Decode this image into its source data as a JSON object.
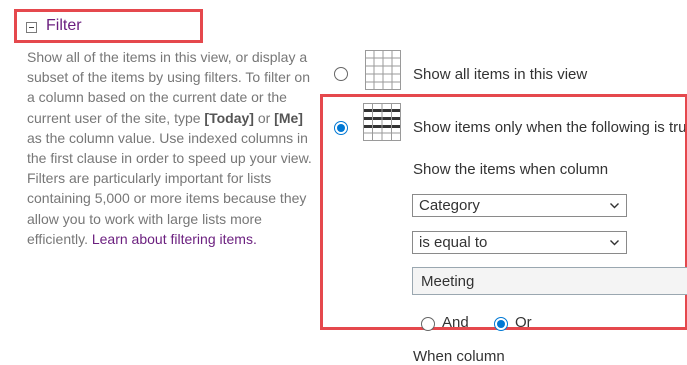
{
  "section": {
    "title": "Filter",
    "description_parts": [
      "Show all of the items in this view, or display a subset of the items by using filters. To filter on a column based on the current date or the current user of the site, type ",
      "[Today]",
      " or ",
      "[Me]",
      " as the column value. Use indexed columns in the first clause in order to speed up your view. Filters are particularly important for lists containing 5,000 or more items because they allow you to work with large lists more efficiently. "
    ],
    "learn_link": "Learn about filtering items."
  },
  "options": {
    "show_all_label": "Show all items in this view",
    "show_filtered_label": "Show items only when the following is true:",
    "selected": "filtered"
  },
  "filter": {
    "caption": "Show the items when column",
    "column": "Category",
    "operator": "is equal to",
    "value": "Meeting",
    "and_label": "And",
    "or_label": "Or",
    "logic_selected": "Or",
    "next_caption": "When column"
  },
  "colors": {
    "highlight": "#e5484d",
    "accent": "#0078d4",
    "title": "#6b1f7f"
  },
  "icons": {
    "collapse": "minus-square-icon",
    "view_all": "grid-icon",
    "view_filtered": "filtered-grid-icon",
    "dropdown": "chevron-down-icon"
  }
}
